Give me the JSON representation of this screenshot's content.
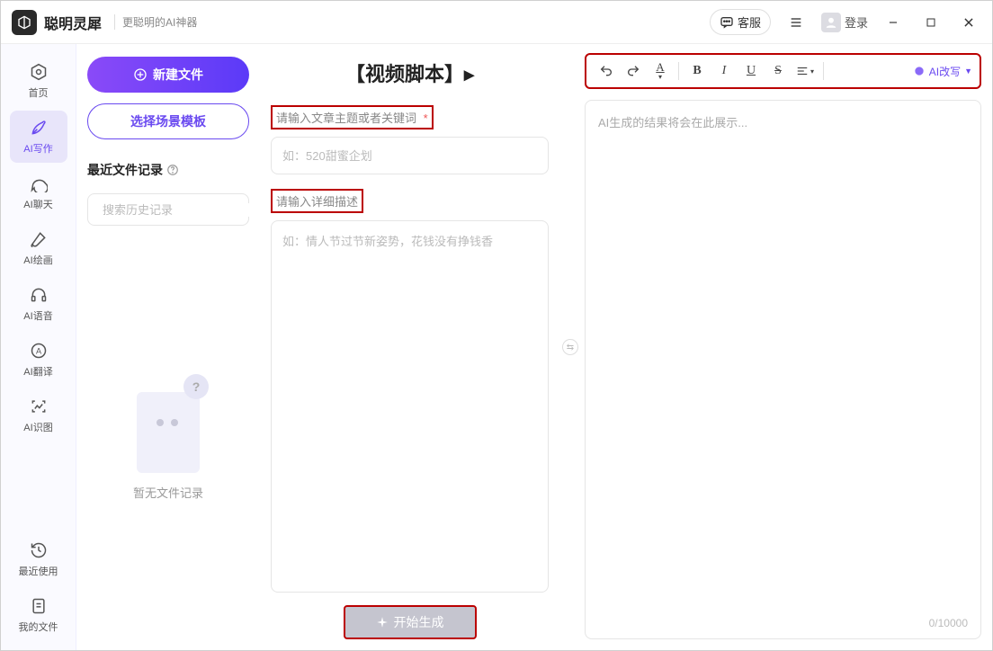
{
  "header": {
    "app_name": "聪明灵犀",
    "tagline": "更聪明的AI神器",
    "kefu_label": "客服",
    "login_label": "登录"
  },
  "sidebar": {
    "items": [
      {
        "label": "首页"
      },
      {
        "label": "AI写作"
      },
      {
        "label": "AI聊天"
      },
      {
        "label": "AI绘画"
      },
      {
        "label": "AI语音"
      },
      {
        "label": "AI翻译"
      },
      {
        "label": "AI识图"
      }
    ],
    "bottom_items": [
      {
        "label": "最近使用"
      },
      {
        "label": "我的文件"
      }
    ],
    "active_index": 1
  },
  "left_panel": {
    "new_file_label": "新建文件",
    "select_template_label": "选择场景模板",
    "recent_label": "最近文件记录",
    "search_placeholder": "搜索历史记录",
    "empty_label": "暂无文件记录"
  },
  "center": {
    "title": "【视频脚本】▸",
    "topic_label": "请输入文章主题或者关键词",
    "topic_required": "*",
    "topic_placeholder": "如：520甜蜜企划",
    "detail_label": "请输入详细描述",
    "detail_placeholder": "如：情人节过节新姿势，花钱没有挣钱香",
    "generate_label": "开始生成"
  },
  "right": {
    "ai_rewrite_label": "AI改写",
    "output_placeholder": "AI生成的结果将会在此展示...",
    "char_count": "0/10000"
  }
}
